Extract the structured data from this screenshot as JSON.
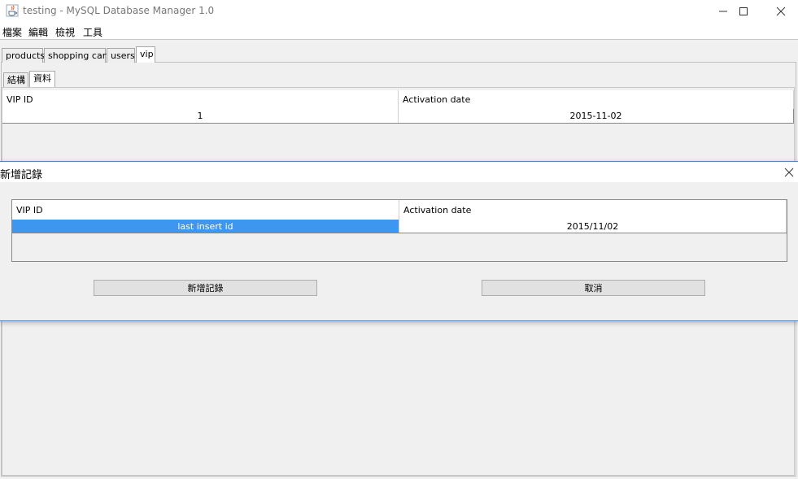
{
  "window": {
    "title": "testing - MySQL Database Manager 1.0",
    "minimize": "—",
    "maximize": "☐",
    "close": "✕"
  },
  "menu": {
    "items": [
      "檔案",
      "編輯",
      "檢視",
      "工具"
    ]
  },
  "table_tabs": [
    "products",
    "shopping cart",
    "users",
    "vip"
  ],
  "selected_table_tab": "vip",
  "view_tabs": [
    "結構",
    "資料"
  ],
  "selected_view_tab": "資料",
  "main_table": {
    "columns": [
      "VIP ID",
      "Activation date"
    ],
    "rows": [
      [
        "1",
        "2015-11-02"
      ]
    ]
  },
  "dialog": {
    "title": "新增記錄",
    "close": "✕",
    "table": {
      "columns": [
        "VIP ID",
        "Activation date"
      ],
      "rows": [
        [
          "last insert id",
          "2015/11/02"
        ]
      ]
    },
    "buttons": {
      "add": "新增記錄",
      "cancel": "取消"
    }
  },
  "colors": {
    "selection": "#3d96f0",
    "dialog_border": "#5a7fbf"
  }
}
